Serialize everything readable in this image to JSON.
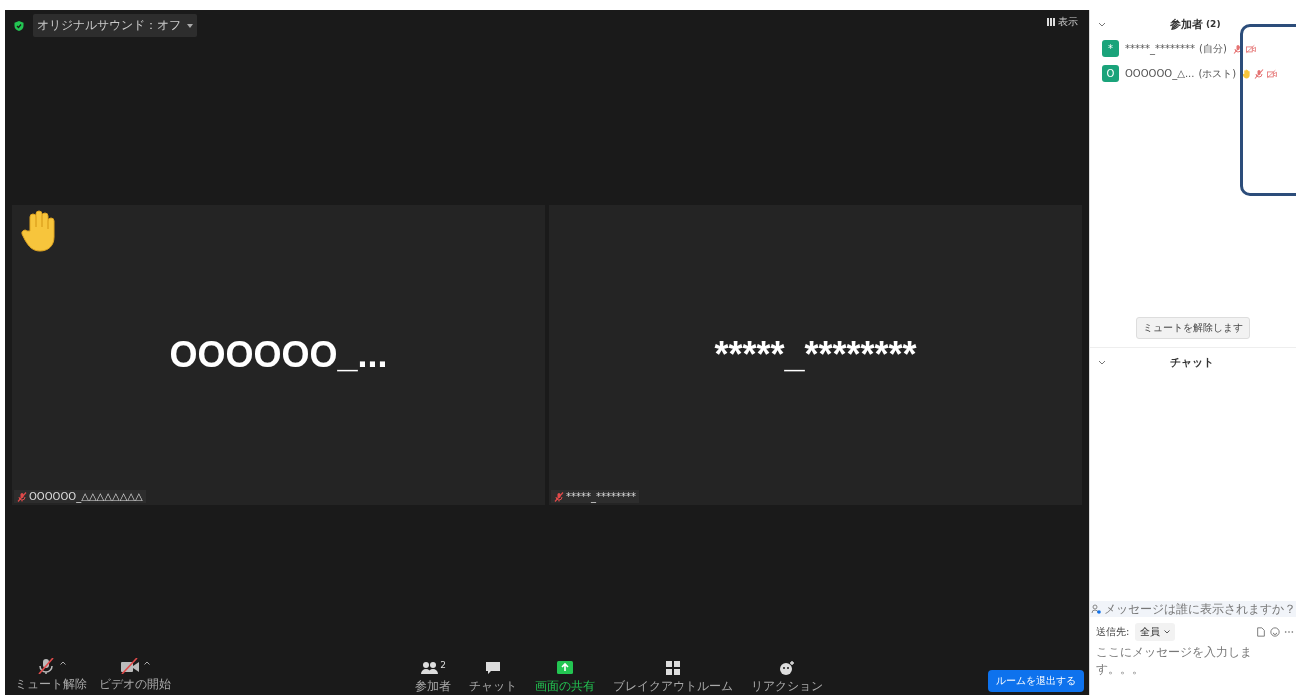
{
  "top_bar": {
    "security": true,
    "sound_menu": "オリジナルサウンド：オフ",
    "view_button": "表示"
  },
  "tiles": [
    {
      "display_name": "OOOOOO_...",
      "label": "OOOOOO_△△△△△△△△",
      "hand_raised": true,
      "mic_muted": true
    },
    {
      "display_name": "*****_********",
      "label": "*****_********",
      "hand_raised": false,
      "mic_muted": true
    }
  ],
  "toolbar": {
    "left": [
      {
        "kind": "mic",
        "label": "ミュート解除",
        "off": true
      },
      {
        "kind": "video",
        "label": "ビデオの開始",
        "off": true
      }
    ],
    "center": [
      {
        "kind": "participants",
        "label": "参加者",
        "count": "2",
        "active": false
      },
      {
        "kind": "chat",
        "label": "チャット",
        "active": false
      },
      {
        "kind": "share",
        "label": "画面の共有",
        "active": true
      },
      {
        "kind": "breakout",
        "label": "ブレイクアウトルーム",
        "active": false
      },
      {
        "kind": "reaction",
        "label": "リアクション",
        "active": false
      }
    ],
    "leave_button": "ルームを退出する"
  },
  "participants_panel": {
    "title": "参加者",
    "count": "(2)",
    "expanded": true,
    "participants": [
      {
        "initial": "*",
        "name": "*****_********",
        "role": "(自分)",
        "hand_raised": false,
        "mic_muted": true,
        "video_off": true
      },
      {
        "initial": "O",
        "name": "OOOOOO_△...",
        "role": "(ホスト)",
        "hand_raised": true,
        "mic_muted": true,
        "video_off": true
      }
    ],
    "unmute_button": "ミュートを解除します"
  },
  "chat_panel": {
    "title": "チャット",
    "expanded": true,
    "visibility_hint": "メッセージは誰に表示されますか？",
    "send_to_label": "送信先:",
    "recipient": "全員",
    "message": {
      "placeholder": "ここにメッセージを入力します。。。"
    }
  }
}
